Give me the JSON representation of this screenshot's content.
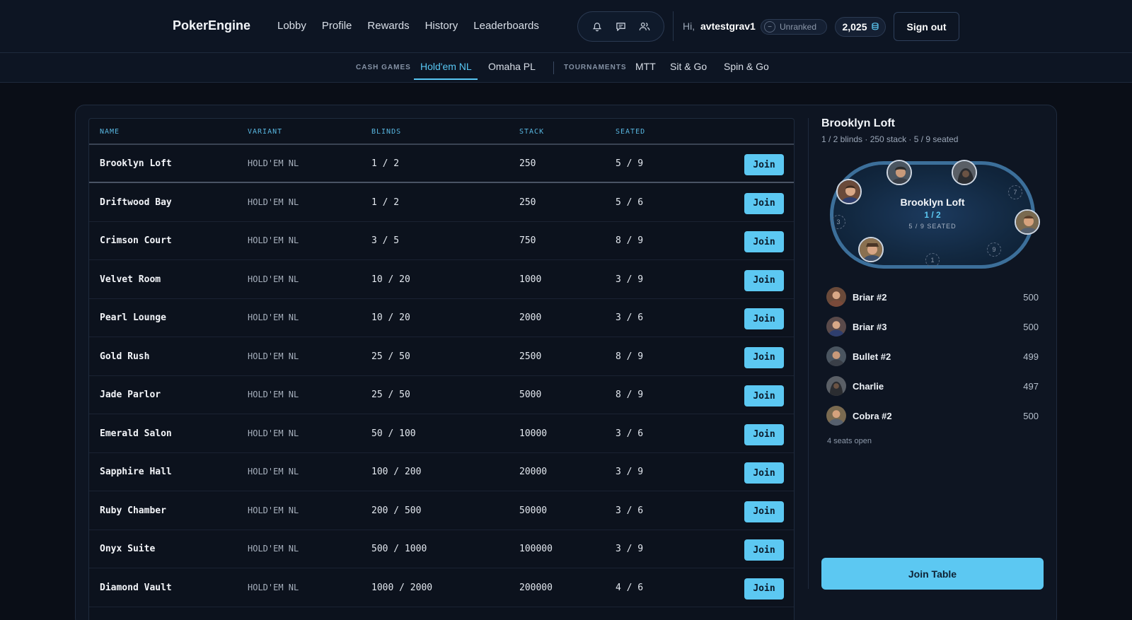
{
  "header": {
    "brand": "PokerEngine",
    "nav": [
      "Lobby",
      "Profile",
      "Rewards",
      "History",
      "Leaderboards"
    ],
    "icons": [
      "bell-icon",
      "chat-icon",
      "friends-icon"
    ],
    "greeting_prefix": "Hi,",
    "username": "avtestgrav1",
    "rank": "Unranked",
    "rank_icon_symbol": "−",
    "chip_balance": "2,025",
    "sign_out": "Sign out"
  },
  "subnav": {
    "cash_label": "CASH GAMES",
    "cash_tabs": [
      "Hold'em NL",
      "Omaha PL"
    ],
    "tournament_label": "TOURNAMENTS",
    "tournament_tabs": [
      "MTT",
      "Sit & Go",
      "Spin & Go"
    ],
    "active_tab": "Hold'em NL"
  },
  "table": {
    "columns": [
      "NAME",
      "VARIANT",
      "BLINDS",
      "STACK",
      "SEATED"
    ],
    "join_label": "Join",
    "rows": [
      {
        "name": "Brooklyn Loft",
        "variant": "HOLD'EM NL",
        "blinds": "1 / 2",
        "stack": "250",
        "seated": "5 / 9"
      },
      {
        "name": "Driftwood Bay",
        "variant": "HOLD'EM NL",
        "blinds": "1 / 2",
        "stack": "250",
        "seated": "5 / 6"
      },
      {
        "name": "Crimson Court",
        "variant": "HOLD'EM NL",
        "blinds": "3 / 5",
        "stack": "750",
        "seated": "8 / 9"
      },
      {
        "name": "Velvet Room",
        "variant": "HOLD'EM NL",
        "blinds": "10 / 20",
        "stack": "1000",
        "seated": "3 / 9"
      },
      {
        "name": "Pearl Lounge",
        "variant": "HOLD'EM NL",
        "blinds": "10 / 20",
        "stack": "2000",
        "seated": "3 / 6"
      },
      {
        "name": "Gold Rush",
        "variant": "HOLD'EM NL",
        "blinds": "25 / 50",
        "stack": "2500",
        "seated": "8 / 9"
      },
      {
        "name": "Jade Parlor",
        "variant": "HOLD'EM NL",
        "blinds": "25 / 50",
        "stack": "5000",
        "seated": "8 / 9"
      },
      {
        "name": "Emerald Salon",
        "variant": "HOLD'EM NL",
        "blinds": "50 / 100",
        "stack": "10000",
        "seated": "3 / 6"
      },
      {
        "name": "Sapphire Hall",
        "variant": "HOLD'EM NL",
        "blinds": "100 / 200",
        "stack": "20000",
        "seated": "3 / 9"
      },
      {
        "name": "Ruby Chamber",
        "variant": "HOLD'EM NL",
        "blinds": "200 / 500",
        "stack": "50000",
        "seated": "3 / 6"
      },
      {
        "name": "Onyx Suite",
        "variant": "HOLD'EM NL",
        "blinds": "500 / 1000",
        "stack": "100000",
        "seated": "3 / 9"
      },
      {
        "name": "Diamond Vault",
        "variant": "HOLD'EM NL",
        "blinds": "1000 / 2000",
        "stack": "200000",
        "seated": "4 / 6"
      }
    ]
  },
  "detail": {
    "title": "Brooklyn Loft",
    "subtitle": "1 / 2 blinds · 250 stack · 5 / 9 seated",
    "felt_name": "Brooklyn Loft",
    "felt_blinds": "1 / 2",
    "felt_seated": "5 / 9 SEATED",
    "empty_seats": [
      "7",
      "3",
      "9",
      "1"
    ],
    "players": [
      {
        "name": "Briar #2",
        "stack": "500"
      },
      {
        "name": "Briar #3",
        "stack": "500"
      },
      {
        "name": "Bullet #2",
        "stack": "499"
      },
      {
        "name": "Charlie",
        "stack": "497"
      },
      {
        "name": "Cobra #2",
        "stack": "500"
      }
    ],
    "seats_open": "4 seats open",
    "join_table": "Join Table"
  },
  "colors": {
    "accent": "#5cc8f2",
    "background": "#0a0e17",
    "panel": "#0e1522"
  }
}
